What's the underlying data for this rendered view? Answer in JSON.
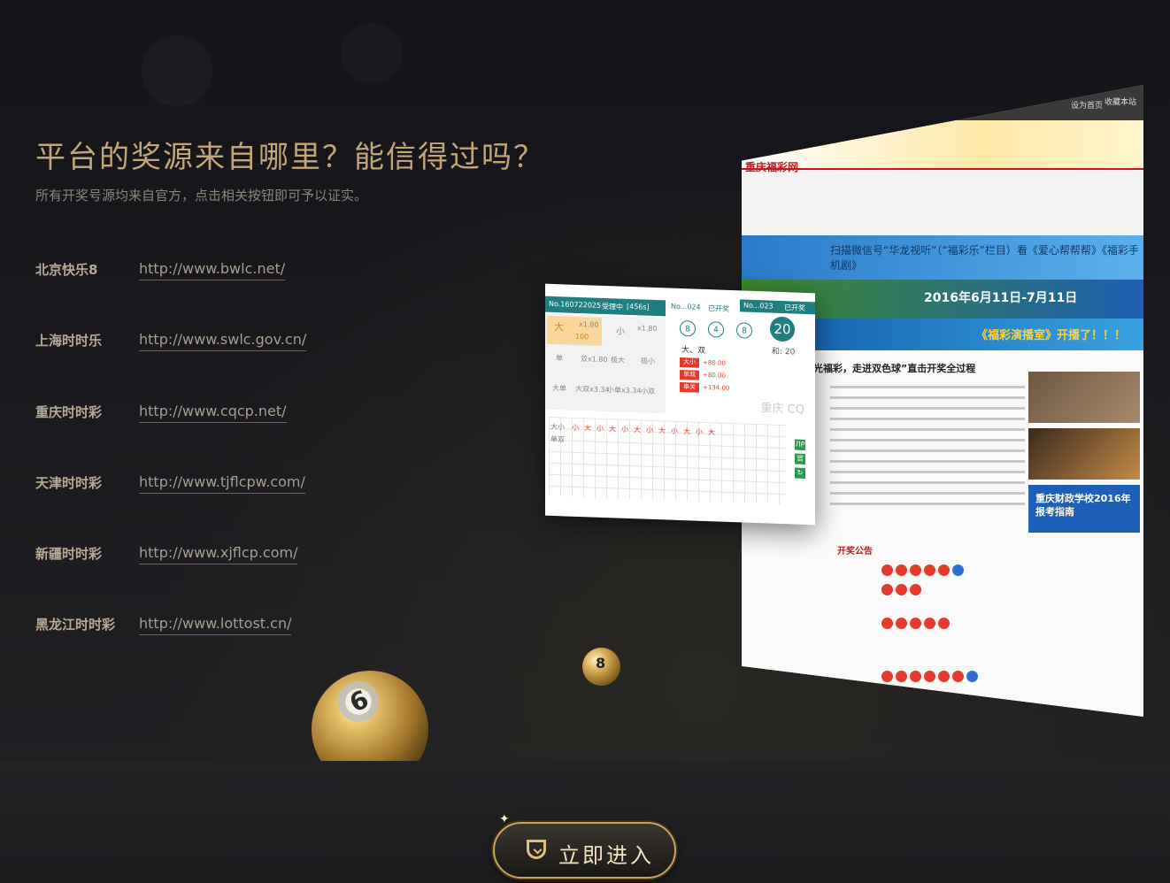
{
  "hero": {
    "headline": "平台的奖源来自哪里？能信得过吗？",
    "subline": "所有开奖号源均来自官方，点击相关按钮即可予以证实。"
  },
  "sources": [
    {
      "name": "北京快乐8",
      "url": "http://www.bwlc.net/"
    },
    {
      "name": "上海时时乐",
      "url": "http://www.swlc.gov.cn/"
    },
    {
      "name": "重庆时时彩",
      "url": "http://www.cqcp.net/"
    },
    {
      "name": "天津时时彩",
      "url": "http://www.tjflcpw.com/"
    },
    {
      "name": "新疆时时彩",
      "url": "http://www.xjflcp.com/"
    },
    {
      "name": "黑龙江时时彩",
      "url": "http://www.lottost.cn/"
    }
  ],
  "site_preview": {
    "top_btn1": "设为首页",
    "top_btn2": "收藏本站",
    "logo": "重庆福彩网",
    "banner1": "扫描微信号“华龙视听”（“福彩乐”栏目）看《爱心帮帮帮》《福彩手机剧》",
    "banner2": "2016年6月11日-7月11日",
    "banner3": "《福彩演播室》开播了！！！",
    "headline": "阳光福彩，走进双色球”直击开奖全过程",
    "ad": "重庆财政学校2016年报考指南",
    "announce": "开奖公告"
  },
  "widget": {
    "issue": "No.160722025",
    "status": "受理中",
    "odds_code": "[456s]",
    "big_label": "大",
    "big_odds": "x1.80",
    "big_amount": "100",
    "small_label": "小",
    "small_odds": "x1.80",
    "cells": [
      "单",
      "双x1.80",
      "极大",
      "极小",
      "大单",
      "大双x3.34",
      "小单x3.34",
      "小双"
    ],
    "res_issue": "No...024",
    "res_status": "已开奖",
    "res_issue2": "No...023",
    "res_status2": "已开奖",
    "balls": [
      "8",
      "4",
      "8"
    ],
    "sum": "20",
    "sum_label": "和: 20",
    "result_text": "大、双",
    "bets": [
      {
        "tag": "大小",
        "value": "+80.00"
      },
      {
        "tag": "单双",
        "value": "+80.00"
      },
      {
        "tag": "串关",
        "value": "+134.00"
      }
    ],
    "city": "重庆 CQ",
    "trend_label1": "大小",
    "trend_label2": "单双",
    "trend_marks": [
      "小",
      "大",
      "小",
      "大",
      "小",
      "大",
      "小",
      "大",
      "小",
      "大",
      "小",
      "大"
    ],
    "side_btns": [
      "ЛР",
      "官",
      "↻"
    ]
  },
  "balls": {
    "big_number": "6",
    "small_number": "8"
  },
  "cta": {
    "label": "立即进入"
  },
  "colors": {
    "accent_gold": "#c3a57a",
    "teal": "#1f7f7f",
    "red": "#e23b2e"
  }
}
